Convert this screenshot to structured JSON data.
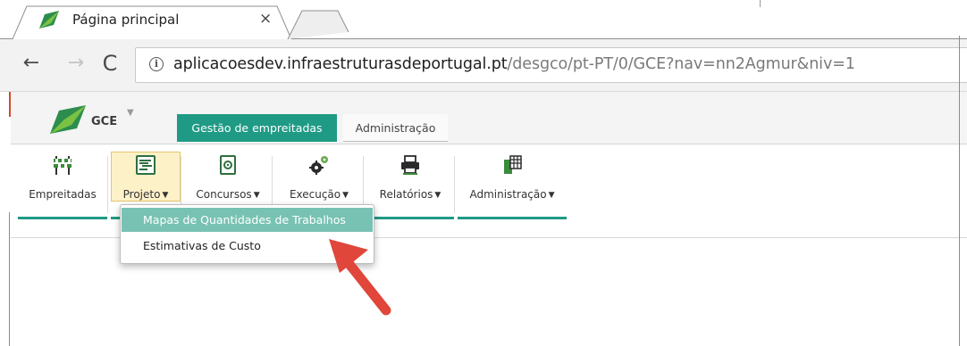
{
  "browser": {
    "tab_title": "Página principal",
    "tab_close": "×",
    "url_host": "aplicacoesdev.infraestruturasdeportugal.pt",
    "url_path": "/desgco/pt-PT/0/GCE?nav=nn2Agmur&niv=1",
    "info_icon": "i",
    "back_icon": "←",
    "forward_icon": "→",
    "reload_icon": "C"
  },
  "app": {
    "name": "GCE",
    "name_caret": "▼",
    "modules": [
      {
        "label": "Gestão de empreitadas",
        "active": true
      },
      {
        "label": "Administração",
        "active": false
      }
    ]
  },
  "ribbon": {
    "items": [
      {
        "label": "Empreitadas",
        "icon": "worksite-barrier-icon",
        "has_caret": false
      },
      {
        "label": "Projeto",
        "icon": "project-map-icon",
        "has_caret": true,
        "active": true
      },
      {
        "label": "Concursos",
        "icon": "tender-document-icon",
        "has_caret": true
      },
      {
        "label": "Execução",
        "icon": "gears-icon",
        "has_caret": true
      },
      {
        "label": "Relatórios",
        "icon": "printer-icon",
        "has_caret": true
      },
      {
        "label": "Administração",
        "icon": "admin-grid-icon",
        "has_caret": true
      }
    ],
    "caret": "▼"
  },
  "dropdown": {
    "items": [
      {
        "label": "Mapas de Quantidades de Trabalhos",
        "highlighted": true
      },
      {
        "label": "Estimativas de Custo",
        "highlighted": false
      }
    ]
  },
  "colors": {
    "accent": "#1f9a85",
    "highlight": "#78c2b3",
    "active_bg": "#fdf1c8",
    "arrow": "#e0463a"
  }
}
